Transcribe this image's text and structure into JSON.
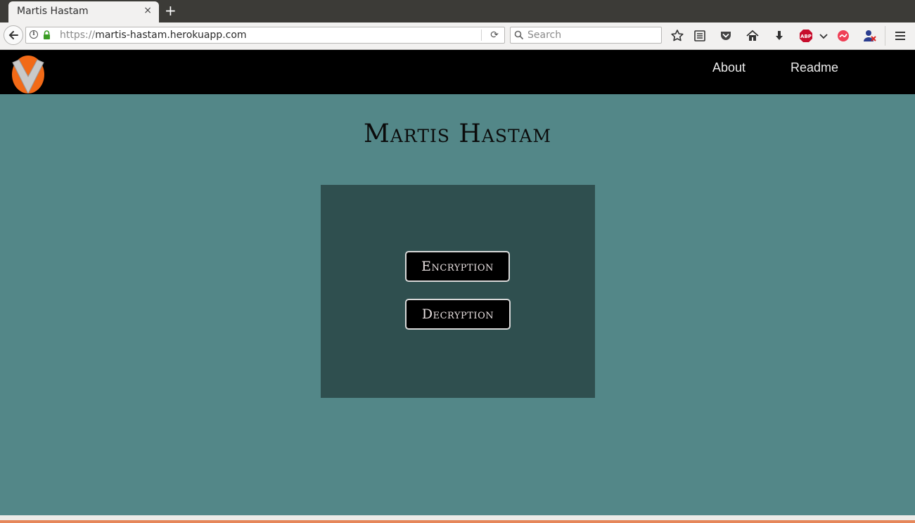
{
  "browser": {
    "tab_title": "Martis Hastam",
    "tab_close": "×",
    "new_tab": "+",
    "url_protocol": "https://",
    "url_host": "martis-hastam.herokuapp.com",
    "search_placeholder": "Search",
    "toolbar_icons": [
      "bookmark-star-icon",
      "reader-list-icon",
      "pocket-icon",
      "home-icon",
      "download-icon",
      "adblock-plus-icon",
      "dropdown-arrow-icon",
      "pocket-red-icon",
      "account-icon",
      "hamburger-menu-icon"
    ],
    "adblock_label": "ABP"
  },
  "site": {
    "nav": {
      "logo_icon": "v-logo-icon",
      "links": [
        "About",
        "Readme"
      ]
    },
    "title": "Martis Hastam",
    "buttons": {
      "encryption": "Encryption",
      "decryption": "Decryption"
    },
    "colors": {
      "background": "#538788",
      "panel": "#2f4f4f",
      "nav": "#000000",
      "logo_orange": "#f26a17",
      "footer_accent": "#e6875a"
    }
  }
}
